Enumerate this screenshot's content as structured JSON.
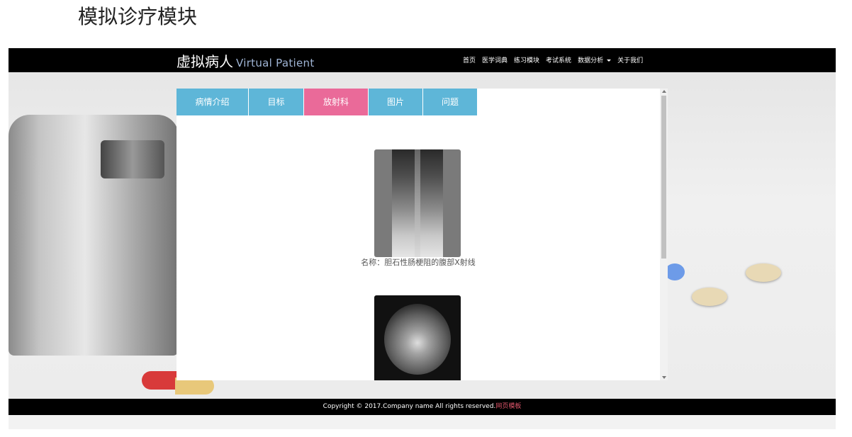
{
  "page": {
    "title": "模拟诊疗模块"
  },
  "navbar": {
    "brand_cn": "虚拟病人",
    "brand_en": "Virtual Patient",
    "items": [
      "首页",
      "医学词典",
      "练习模块",
      "考试系统",
      "数据分析",
      "关于我们"
    ]
  },
  "tabs": [
    {
      "label": "病情介绍",
      "active": false
    },
    {
      "label": "目标",
      "active": false
    },
    {
      "label": "放射科",
      "active": true
    },
    {
      "label": "图片",
      "active": false
    },
    {
      "label": "问题",
      "active": false
    }
  ],
  "content": {
    "xray_caption": "名称：胆石性肠梗阻的腹部X射线"
  },
  "footer": {
    "text": "Copyright © 2017.Company name All rights reserved.",
    "link": "网页模板"
  },
  "colors": {
    "tab": "#5eb6d8",
    "tab_active": "#ea6a99",
    "navbar": "#000000"
  }
}
